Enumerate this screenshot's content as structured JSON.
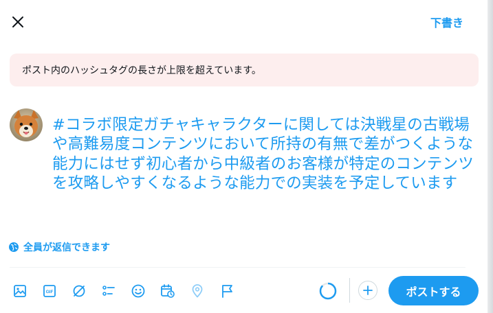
{
  "header": {
    "close_icon": "close-icon",
    "drafts_label": "下書き"
  },
  "error": {
    "message": "ポスト内のハッシュタグの長さが上限を超えています。"
  },
  "composer": {
    "avatar": "dog-avatar",
    "text": "#コラボ限定ガチャキャラクターに関しては決戦星の古戦場や高難易度コンテンツにおいて所持の有無で差がつくような能力にはせず初心者から中級者のお客様が特定のコンテンツを攻略しやすくなるような能力での実装を予定しています"
  },
  "reply_setting": {
    "icon": "globe-icon",
    "label": "全員が返信できます"
  },
  "toolbar": {
    "icons": [
      "image-icon",
      "gif-icon",
      "grok-icon",
      "poll-icon",
      "emoji-icon",
      "schedule-icon",
      "location-icon",
      "flag-icon"
    ],
    "post_label": "ポストする",
    "add_icon": "plus-icon"
  },
  "colors": {
    "accent": "#1d9bf0",
    "error_bg": "#fdeeee",
    "text": "#0f1419",
    "border": "#cfd9de"
  }
}
